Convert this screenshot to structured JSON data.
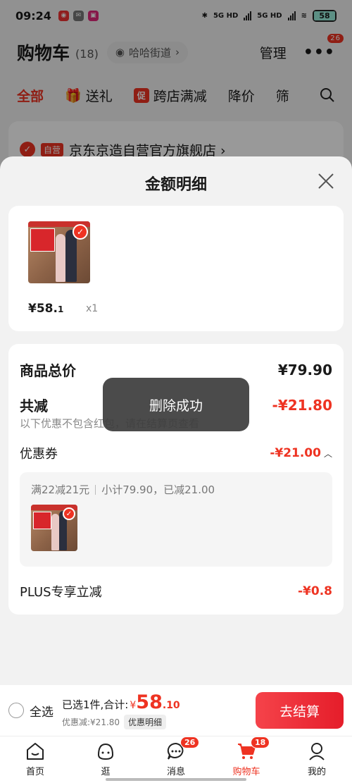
{
  "status_bar": {
    "time": "09:24",
    "net1": "5G HD",
    "net2": "5G HD",
    "battery": "58"
  },
  "header": {
    "title": "购物车",
    "count": "(18)",
    "address": "哈哈街道",
    "manage": "管理",
    "more_badge": "26"
  },
  "filter_tabs": [
    {
      "label": "全部"
    },
    {
      "label": "送礼"
    },
    {
      "promo": "促",
      "label": "跨店满减"
    },
    {
      "label": "降价"
    },
    {
      "label": "筛"
    }
  ],
  "store": {
    "tag": "自营",
    "name": "京东京造自营官方旗舰店 ›"
  },
  "sheet": {
    "title": "金额明细",
    "product": {
      "price_main": "¥58.",
      "price_dec": "1",
      "qty": "x1"
    },
    "total": {
      "label": "商品总价",
      "value": "¥79.90"
    },
    "discount": {
      "label": "共减",
      "value": "-¥21.80",
      "note": "以下优惠不包含红包，请在结算页查看"
    },
    "coupon": {
      "label": "优惠券",
      "value": "-¥21.00",
      "rule": "满22减21元",
      "subtotal": "小计79.90，已减21.00"
    },
    "plus": {
      "label": "PLUS专享立减",
      "value": "-¥0.8"
    }
  },
  "toast": "删除成功",
  "checkout": {
    "select_all": "全选",
    "selected_text": "已选1件,合计:",
    "yen": "¥",
    "total_int": "58",
    "total_dec": ".10",
    "discount_text": "优惠减:¥21.80",
    "detail_btn": "优惠明细",
    "go_btn": "去结算"
  },
  "tabbar": [
    {
      "label": "首页"
    },
    {
      "label": "逛"
    },
    {
      "label": "消息",
      "badge": "26"
    },
    {
      "label": "购物车",
      "badge": "18"
    },
    {
      "label": "我的"
    }
  ],
  "colors": {
    "accent": "#e32222",
    "sheet_bg": "#f2f2f2"
  }
}
